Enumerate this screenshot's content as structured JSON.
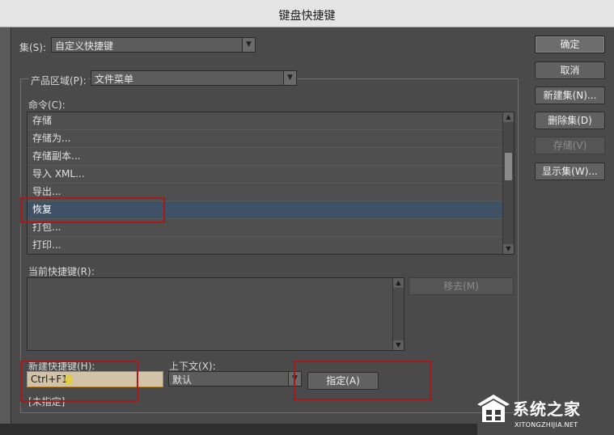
{
  "window": {
    "title": "键盘快捷键"
  },
  "set": {
    "label": "集(S):",
    "value": "自定义快捷键"
  },
  "product_area": {
    "label": "产品区域(P):",
    "value": "文件菜单"
  },
  "commands": {
    "label": "命令(C):",
    "items": [
      "存储",
      "存储为...",
      "存储副本...",
      "导入 XML...",
      "导出...",
      "恢复",
      "打包...",
      "打印..."
    ],
    "selected_index": 5
  },
  "current_shortcut": {
    "label": "当前快捷键(R):",
    "remove_button": "移去(M)"
  },
  "new_shortcut": {
    "label": "新建快捷键(H):",
    "value": "Ctrl+F1"
  },
  "context": {
    "label": "上下文(X):",
    "value": "默认"
  },
  "assign_button": "指定(A)",
  "status_text": "[未指定]",
  "side_buttons": {
    "ok": "确定",
    "cancel": "取消",
    "new_set": "新建集(N)...",
    "delete_set": "删除集(D)",
    "save": "存储(V)",
    "show_set": "显示集(W)..."
  },
  "watermark": {
    "brand": "系统之家",
    "url": "XITONGZHIJIA.NET"
  },
  "colors": {
    "selection": "#3f5164",
    "highlight_box": "#a51a1a",
    "field_border": "#c0882f"
  }
}
